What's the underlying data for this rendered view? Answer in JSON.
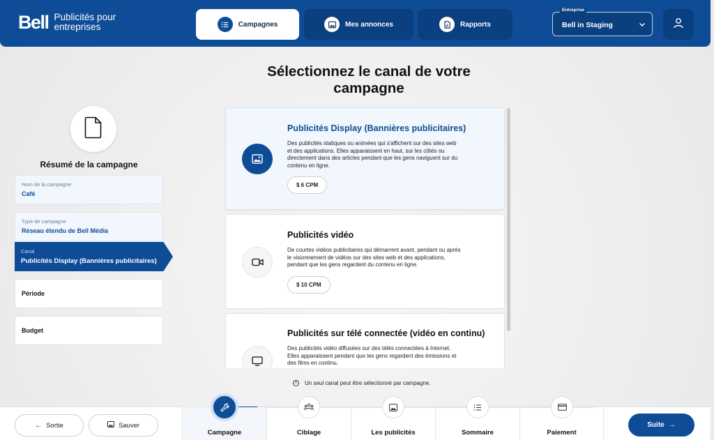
{
  "header": {
    "logo": "Bell",
    "logo_subtitle": "Publicités pour entreprises",
    "nav": [
      {
        "label": "Campagnes",
        "icon": "list-icon",
        "active": true
      },
      {
        "label": "Mes annonces",
        "icon": "image-icon",
        "active": false
      },
      {
        "label": "Rapports",
        "icon": "report-icon",
        "active": false
      }
    ],
    "company_label": "Entreprise",
    "company_value": "Bell in Staging"
  },
  "page_title": "Sélectionnez le canal de votre campagne",
  "summary": {
    "title": "Résumé de la campagne",
    "items": [
      {
        "label": "Nom de la campagne",
        "value": "Café"
      },
      {
        "label": "Type de campagne",
        "value": "Réseau étendu de Bell Média"
      },
      {
        "label": "Canal",
        "value": "Publicités Display (Bannières publicitaires)"
      },
      {
        "label": "Période"
      },
      {
        "label": "Budget"
      }
    ]
  },
  "channels": [
    {
      "title": "Publicités Display (Bannières publicitaires)",
      "description": "Des publicités statiques ou animées qui s'affichent sur des sites web et des applications. Elles apparaissent en haut, sur les côtés ou directement dans des articles pendant que les gens naviguent sur du contenu en ligne.",
      "price": "$ 6 CPM",
      "selected": true
    },
    {
      "title": "Publicités vidéo",
      "description": "De courtes vidéos publicitaires qui démarrent avant, pendant ou après le visionnement de vidéos sur des sites web et des applications, pendant que les gens regardent du contenu en ligne.",
      "price": "$ 10 CPM",
      "selected": false
    },
    {
      "title": "Publicités sur télé connectée (vidéo en continu)",
      "description": "Des publicités vidéo diffusées sur des télés connectées à Internet. Elles apparaissent pendant que les gens regardent des émissions et des films en continu.",
      "selected": false
    }
  ],
  "note": "Un seul canal peut être sélectionné par campagne.",
  "footer": {
    "exit_label": "Sortie",
    "save_label": "Sauver",
    "steps": [
      "Campagne",
      "Ciblage",
      "Les publicités",
      "Sommaire",
      "Paiement"
    ],
    "next_label": "Suite"
  },
  "colors": {
    "brand": "#0e4c97",
    "selected_card": "#f1f7fd"
  }
}
